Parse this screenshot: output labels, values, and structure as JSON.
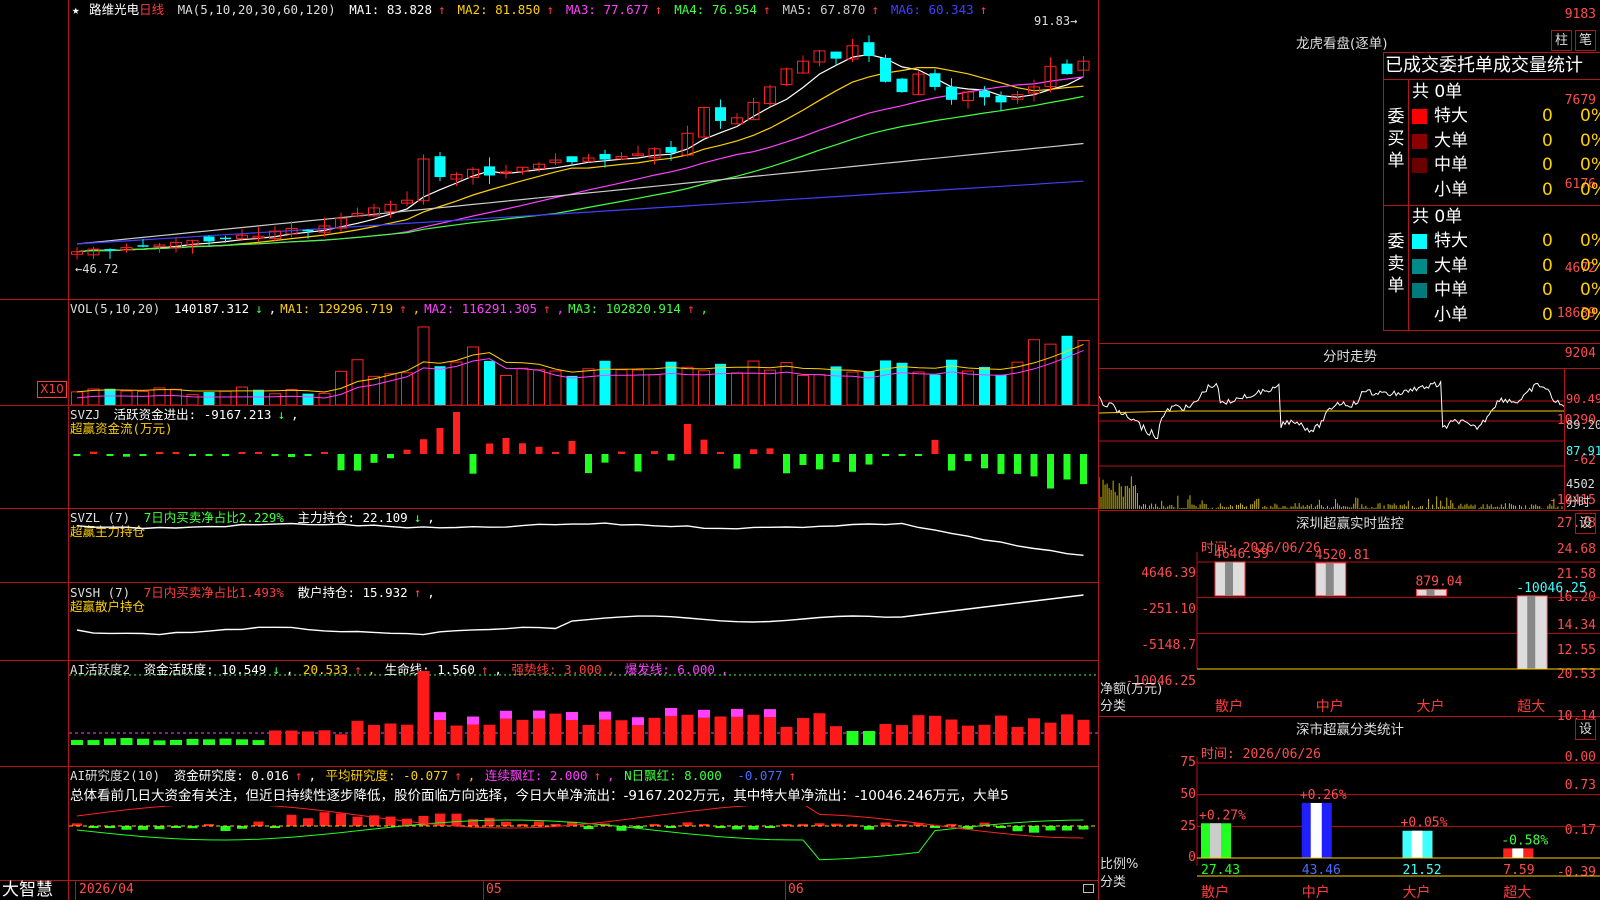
{
  "app": {
    "brand": "大智慧",
    "stock_name": "路维光电",
    "period": "日线",
    "star": "★",
    "high_label": "91.83",
    "low_label": "46.72"
  },
  "main_panel": {
    "ma_label": "MA(5,10,20,30,60,120)",
    "ma_items": [
      {
        "text": "MA1: 83.828",
        "arrow": "↑",
        "color": "#ffffff"
      },
      {
        "text": "MA2: 81.850",
        "arrow": "↑",
        "color": "#ffd000"
      },
      {
        "text": "MA3: 77.677",
        "arrow": "↑",
        "color": "#ff40ff"
      },
      {
        "text": "MA4: 76.954",
        "arrow": "↑",
        "color": "#40ff40"
      },
      {
        "text": "MA5: 67.870",
        "arrow": "↑",
        "color": "#cccccc"
      },
      {
        "text": "MA6: 60.343",
        "arrow": "↑",
        "color": "#4040ff"
      }
    ],
    "y_ticks": [
      "9183",
      "7679",
      "6176",
      "4672"
    ]
  },
  "vol_panel": {
    "label": "VOL(5,10,20)",
    "items": [
      {
        "text": "140187.312",
        "arrow": "↓",
        "color": "#ffffff"
      },
      {
        "text": "MA1: 129296.719",
        "arrow": "↑",
        "color": "#ffd000"
      },
      {
        "text": "MA2: 116291.305",
        "arrow": "↑",
        "color": "#ff40ff"
      },
      {
        "text": "MA3: 102820.914",
        "arrow": "↑",
        "color": "#40ff40"
      }
    ],
    "y_ticks": [
      "18639",
      "9204"
    ],
    "unit_badge": "X10"
  },
  "svzj_panel": {
    "label": "SVZJ",
    "item": "活跃资金进出: -9167.213",
    "arrow": "↓",
    "subtitle": "超赢资金流(万元)",
    "y_ticks": [
      "10290",
      "-62",
      "-10415"
    ]
  },
  "svzl_panel": {
    "label": "SVZL (7)",
    "item1": "7日内买卖净占比2.229%",
    "item2": "主力持仓: 22.109",
    "arrow": "↓",
    "subtitle": "超赢主力持仓",
    "y_ticks": [
      "27.78",
      "24.68",
      "21.58"
    ]
  },
  "svsh_panel": {
    "label": "SVSH (7)",
    "item1": "7日内买卖净占比1.493%",
    "item2": "散户持仓: 15.932",
    "arrow": "↑",
    "subtitle": "超赢散户持仓",
    "y_ticks": [
      "16.20",
      "14.34",
      "12.55"
    ]
  },
  "ai_active_panel": {
    "label": "AI活跃度2",
    "item1": "资金活跃度: 10.549",
    "item2": "20.533",
    "item3": "生命线: 1.560",
    "item4": "强势线: 3.000",
    "item5": "爆发线: 6.000",
    "y_ticks": [
      "20.53",
      "10.14",
      "0.00"
    ]
  },
  "ai_research_panel": {
    "label": "AI研究度2(10)",
    "item1": "资金研究度: 0.016",
    "item2": "平均研究度: -0.077",
    "item3": "连续飘红: 2.000",
    "item4": "N日飘红: 8.000",
    "item5": "-0.077",
    "summary": "总体看前几日大资金有关注，但近日持续性逐步降低，股价面临方向选择，今日大单净流出：-9167.202万元，其中特大单净流出：-10046.246万元，大单5",
    "y_ticks": [
      "0.73",
      "0.17",
      "-0.39"
    ],
    "x_labels": [
      "2026/04",
      "05",
      "06"
    ]
  },
  "dragon_tiger": {
    "title": "龙虎看盘(逐单)",
    "btn_bar": "柱",
    "btn_pen": "笔",
    "header": "已成交委托单成交量统计",
    "buy": {
      "side": "委买单",
      "total": "共 0单",
      "rows": [
        {
          "name": "特大",
          "count": "0",
          "pct": "0%",
          "color": "#ff0000"
        },
        {
          "name": "大单",
          "count": "0",
          "pct": "0%",
          "color": "#8b0000"
        },
        {
          "name": "中单",
          "count": "0",
          "pct": "0%",
          "color": "#6b0000"
        },
        {
          "name": "小单",
          "count": "0",
          "pct": "0%",
          "color": "#000000"
        }
      ]
    },
    "sell": {
      "side": "委卖单",
      "total": "共 0单",
      "rows": [
        {
          "name": "特大",
          "count": "0",
          "pct": "0%",
          "color": "#00ffff"
        },
        {
          "name": "大单",
          "count": "0",
          "pct": "0%",
          "color": "#008b8b"
        },
        {
          "name": "中单",
          "count": "0",
          "pct": "0%",
          "color": "#007a7a"
        },
        {
          "name": "小单",
          "count": "0",
          "pct": "0%",
          "color": "#000000"
        }
      ]
    }
  },
  "intraday": {
    "title": "分时走势",
    "y_ticks": [
      "90.49",
      "89.20",
      "87.91"
    ],
    "vol_tick": "4502",
    "vol_unit": "分时"
  },
  "sz_monitor": {
    "title": "深圳超赢实时监控",
    "btn": "设",
    "time": "时间: 2026/06/26",
    "y_ticks": [
      "4646.39",
      "-251.10",
      "-5148.7",
      "-10046.25"
    ],
    "axis_unit": "净额(万元)",
    "axis_class": "分类"
  },
  "sz_class": {
    "title": "深市超赢分类统计",
    "btn": "设",
    "time": "时间: 2026/06/26",
    "y_ticks": [
      "75",
      "50",
      "25",
      "0"
    ],
    "axis_unit": "比例%",
    "axis_class": "分类"
  },
  "chart_data": [
    {
      "type": "bar",
      "title": "深圳超赢实时监控",
      "ylabel": "净额(万元)",
      "xlabel": "分类",
      "categories": [
        "散户",
        "中户",
        "大户",
        "超大"
      ],
      "values": [
        4646.39,
        4520.81,
        879.04,
        -10046.25
      ],
      "value_labels": [
        "4646.39",
        "4520.81",
        "879.04",
        "-10046.25"
      ],
      "ylim": [
        -10046.25,
        4646.39
      ]
    },
    {
      "type": "bar",
      "title": "深市超赢分类统计",
      "ylabel": "比例%",
      "xlabel": "分类",
      "categories": [
        "散户",
        "中户",
        "大户",
        "超大"
      ],
      "values": [
        27.43,
        43.46,
        21.52,
        7.59
      ],
      "change_labels": [
        "+0.27%",
        "+0.26%",
        "+0.05%",
        "-0.58%"
      ],
      "change_colors": [
        "#ff4d4d",
        "#ff4d4d",
        "#ff4d4d",
        "#40ff40"
      ],
      "ylim": [
        0,
        75
      ]
    }
  ]
}
